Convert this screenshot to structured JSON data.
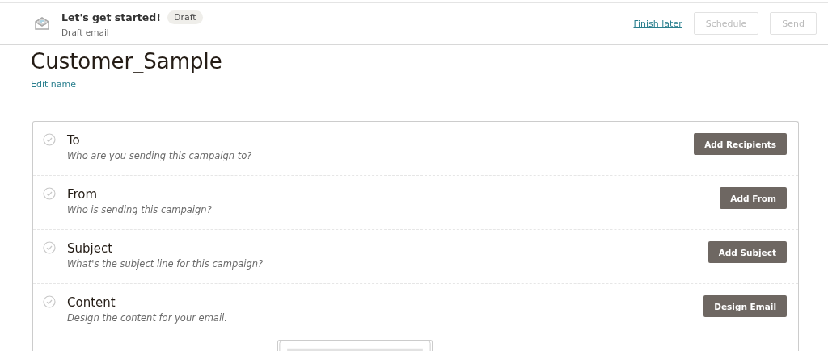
{
  "header": {
    "title": "Let's get started!",
    "badge": "Draft",
    "subtitle": "Draft email",
    "finish_link": "Finish later",
    "buttons": [
      {
        "label": "Schedule",
        "disabled": true
      },
      {
        "label": "Send",
        "disabled": true
      }
    ]
  },
  "campaign": {
    "name": "Customer_Sample",
    "edit_link": "Edit name"
  },
  "sections": [
    {
      "title": "To",
      "hint": "Who are you sending this campaign to?",
      "action": "Add Recipients",
      "done": false
    },
    {
      "title": "From",
      "hint": "Who is sending this campaign?",
      "action": "Add From",
      "done": false
    },
    {
      "title": "Subject",
      "hint": "What's the subject line for this campaign?",
      "action": "Add Subject",
      "done": false
    },
    {
      "title": "Content",
      "hint": "Design the content for your email.",
      "action": "Design Email",
      "done": false,
      "kind": "preview"
    }
  ]
}
